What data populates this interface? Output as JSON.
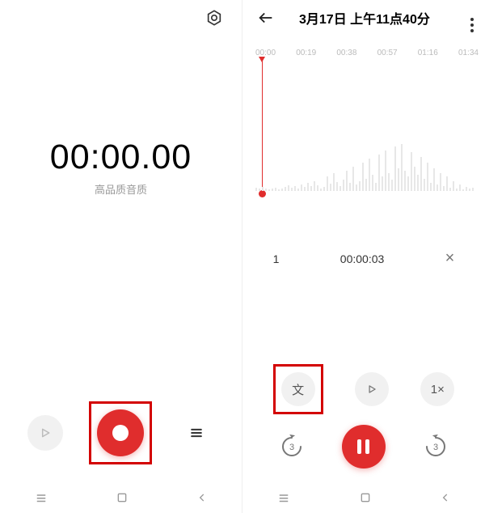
{
  "left": {
    "timer": "00:00.00",
    "quality": "高品质音质"
  },
  "right": {
    "title": "3月17日 上午11点40分",
    "ticks": [
      "00:00",
      "00:19",
      "00:38",
      "00:57",
      "01:16",
      "01:34"
    ],
    "marker": {
      "index": "1",
      "time": "00:00:03"
    },
    "speed_label": "1×",
    "text_label": "文",
    "skip_label": "3"
  }
}
